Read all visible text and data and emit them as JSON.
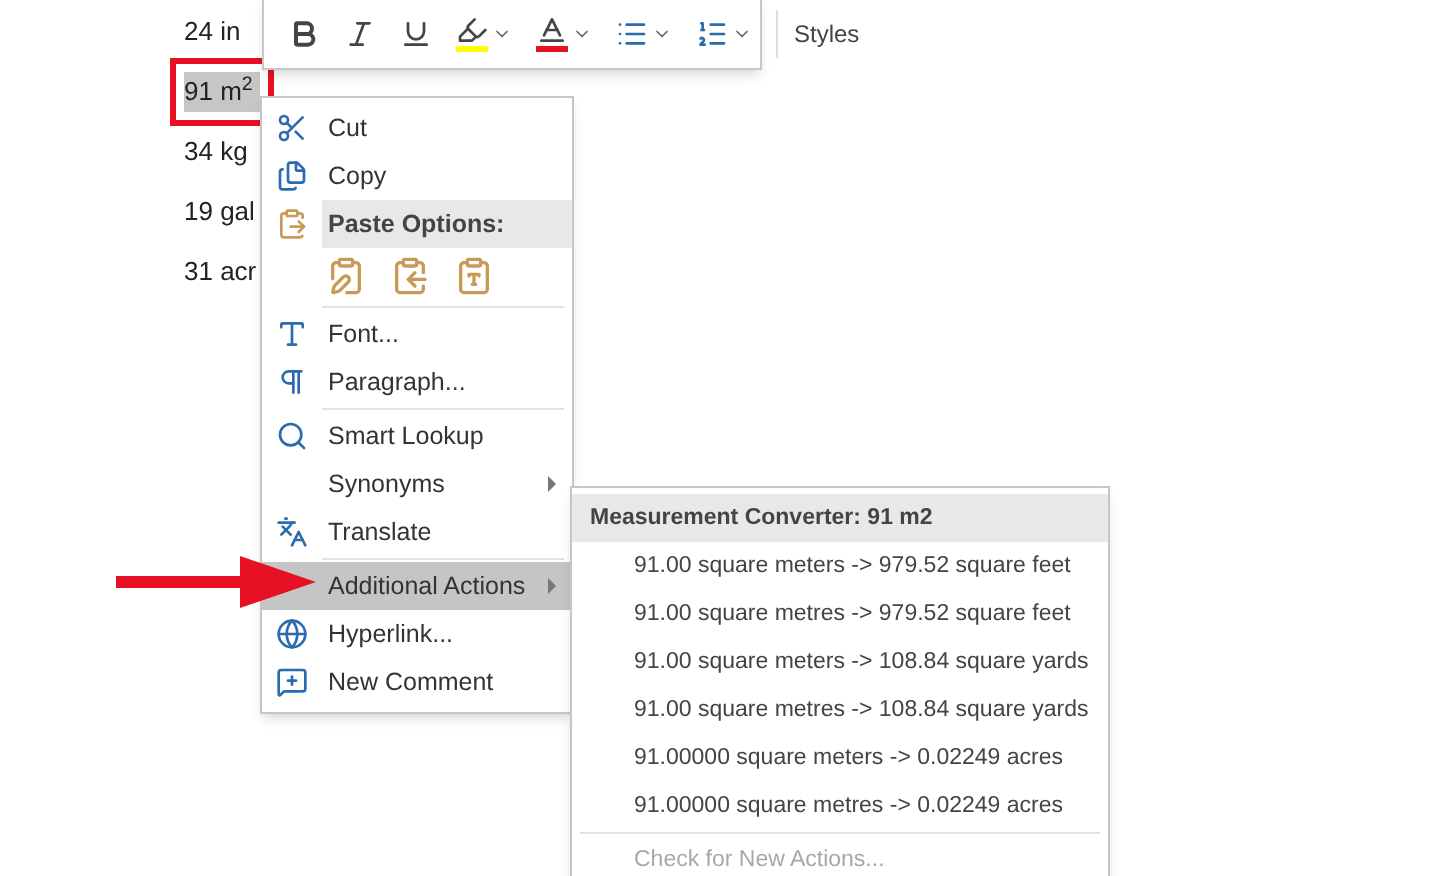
{
  "document": {
    "lines": [
      {
        "text": "24 in",
        "selected": false
      },
      {
        "text": "91 m$^{2}$",
        "selected": true
      },
      {
        "text": "34 kg",
        "selected": false
      },
      {
        "text": "19 gal",
        "selected": false
      },
      {
        "text": "31 acr",
        "selected": false
      }
    ]
  },
  "toolbar": {
    "items": [
      {
        "kind": "bold"
      },
      {
        "kind": "italic"
      },
      {
        "kind": "underline"
      },
      {
        "kind": "highlight",
        "color": "#ffff00"
      },
      {
        "kind": "font-color",
        "color": "#e81123"
      },
      {
        "kind": "bullets"
      },
      {
        "kind": "numbering"
      },
      {
        "kind": "styles",
        "label": "Styles"
      }
    ]
  },
  "context_menu": {
    "items": [
      {
        "kind": "item",
        "label": "Cut",
        "highlighted": false,
        "submenu": false
      },
      {
        "kind": "item",
        "label": "Copy",
        "highlighted": false,
        "submenu": false
      },
      {
        "kind": "header",
        "label": "Paste Options:"
      },
      {
        "kind": "paste-row"
      },
      {
        "kind": "separator"
      },
      {
        "kind": "item",
        "label": "Font...",
        "highlighted": false,
        "submenu": false
      },
      {
        "kind": "item",
        "label": "Paragraph...",
        "highlighted": false,
        "submenu": false
      },
      {
        "kind": "separator"
      },
      {
        "kind": "item",
        "label": "Smart Lookup",
        "highlighted": false,
        "submenu": false
      },
      {
        "kind": "item",
        "label": "Synonyms",
        "highlighted": false,
        "submenu": true
      },
      {
        "kind": "item",
        "label": "Translate",
        "highlighted": false,
        "submenu": false
      },
      {
        "kind": "separator"
      },
      {
        "kind": "item",
        "label": "Additional Actions",
        "highlighted": true,
        "submenu": true
      },
      {
        "kind": "item",
        "label": "Hyperlink...",
        "highlighted": false,
        "submenu": false
      },
      {
        "kind": "item",
        "label": "New Comment",
        "highlighted": false,
        "submenu": false
      }
    ]
  },
  "submenu": {
    "title": "Measurement Converter: 91 m2",
    "items": [
      {
        "label": "91.00 square meters -> 979.52 square feet",
        "disabled": false
      },
      {
        "label": "91.00 square metres -> 979.52 square feet",
        "disabled": false
      },
      {
        "label": "91.00 square meters -> 108.84 square yards",
        "disabled": false
      },
      {
        "label": "91.00 square metres -> 108.84 square yards",
        "disabled": false
      },
      {
        "label": "91.00000 square meters -> 0.02249 acres",
        "disabled": false
      },
      {
        "label": "91.00000 square metres -> 0.02249 acres",
        "disabled": false
      },
      {
        "kind": "separator"
      },
      {
        "label": "Check for New Actions...",
        "disabled": true
      }
    ]
  }
}
